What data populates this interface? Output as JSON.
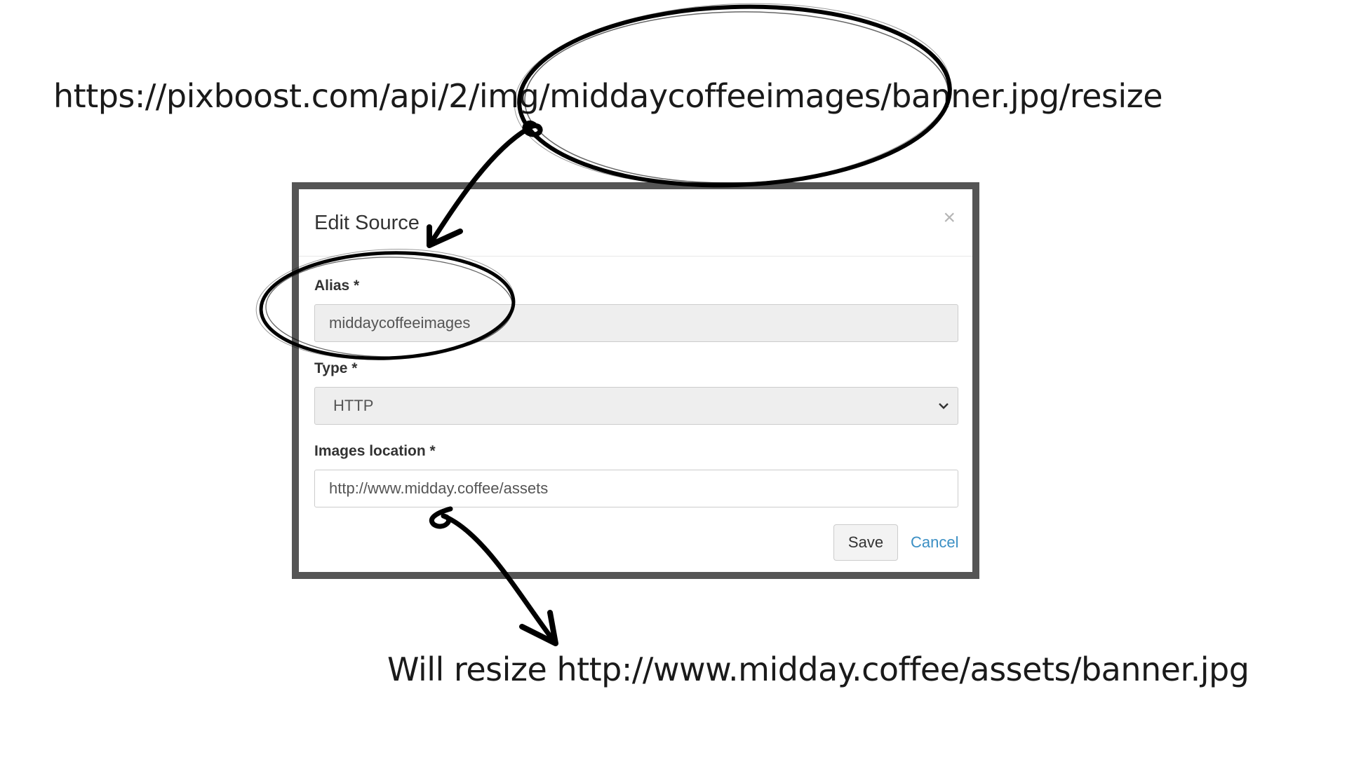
{
  "annotations": {
    "top_url": "https://pixboost.com/api/2/img/middaycoffeeimages/banner.jpg/resize",
    "bottom_note": "Will resize http://www.midday.coffee/assets/banner.jpg"
  },
  "dialog": {
    "title": "Edit Source",
    "close_symbol": "×",
    "alias": {
      "label": "Alias *",
      "value": "middaycoffeeimages"
    },
    "type": {
      "label": "Type *",
      "selected": "HTTP"
    },
    "images_location": {
      "label": "Images location *",
      "value": "http://www.midday.coffee/assets"
    },
    "save_label": "Save",
    "cancel_label": "Cancel"
  },
  "colors": {
    "frame": "#555555",
    "link": "#3b8fc4",
    "ink": "#000000"
  },
  "icons": [
    "close-icon",
    "chevron-down-icon",
    "arrow-icon"
  ]
}
